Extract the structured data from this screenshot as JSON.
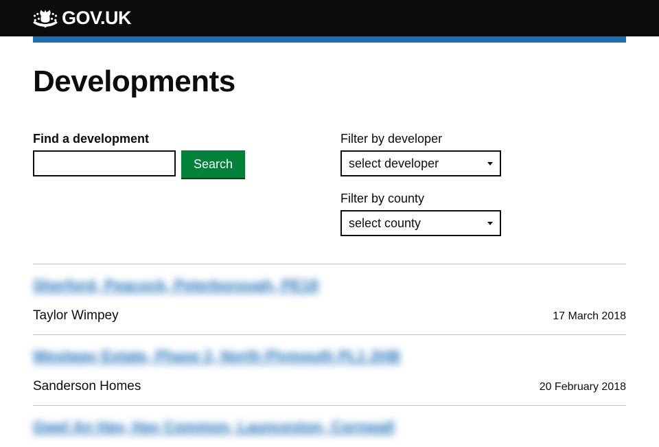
{
  "header": {
    "logo_text": "GOV.UK"
  },
  "page": {
    "title": "Developments"
  },
  "search": {
    "label": "Find a development",
    "button": "Search"
  },
  "filters": {
    "developer": {
      "label": "Filter by developer",
      "selected": "select developer"
    },
    "county": {
      "label": "Filter by county",
      "selected": "select county"
    }
  },
  "results": [
    {
      "title": "Sherford, Peacock, Peterborough, PE18",
      "developer": "Taylor Wimpey",
      "date": "17 March 2018"
    },
    {
      "title": "Westway Estate, Phase 2, North Plymouth PL1 2HB",
      "developer": "Sanderson Homes",
      "date": "20 February 2018"
    },
    {
      "title": "Gwel An Hay, Hay Common, Launceston, Cornwall",
      "developer": "",
      "date": ""
    }
  ]
}
